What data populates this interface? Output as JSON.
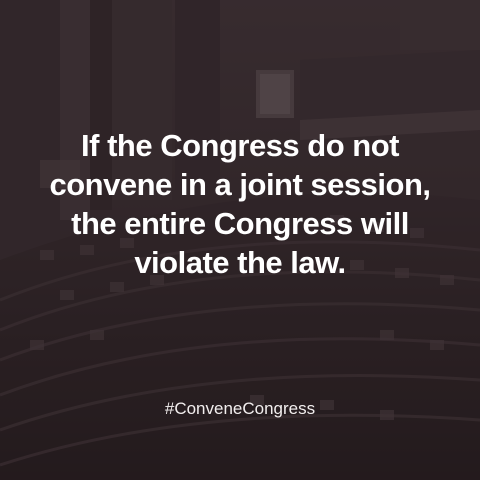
{
  "quote": {
    "lines": [
      "If the Congress do not",
      "convene in a joint session,",
      "the entire Congress will",
      "violate the law."
    ]
  },
  "hashtag": "#ConveneCongress",
  "colors": {
    "overlay": "#2b2325",
    "text": "#ffffff"
  },
  "background": {
    "icon": "legislative-hall-photo"
  }
}
